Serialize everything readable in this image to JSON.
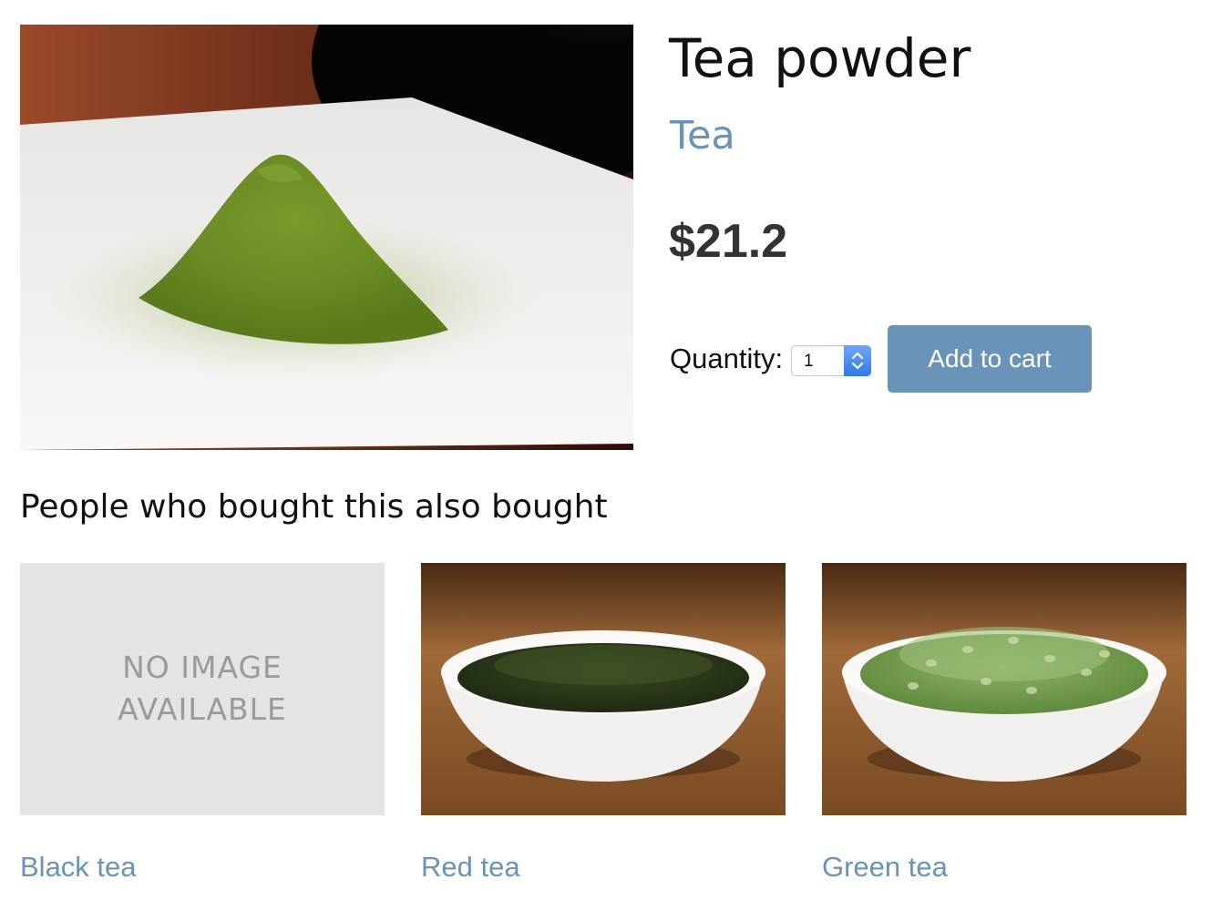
{
  "product": {
    "image_icon": "matcha-powder-photo",
    "title": "Tea powder",
    "category": "Tea",
    "price": "$21.2",
    "quantity_label": "Quantity:",
    "quantity_value": "1",
    "add_to_cart_label": "Add to cart"
  },
  "related": {
    "heading": "People who bought this also bought",
    "items": [
      {
        "name": "Black tea",
        "image": "no-image-placeholder",
        "placeholder_line1": "NO IMAGE",
        "placeholder_line2": "AVAILABLE"
      },
      {
        "name": "Red tea",
        "image": "sencha-leaves-bowl-photo"
      },
      {
        "name": "Green tea",
        "image": "genmaicha-bowl-photo"
      }
    ]
  },
  "colors": {
    "link": "#6a93b6",
    "button_bg": "#6a93b9",
    "button_text": "#ffffff",
    "price_text": "#333333",
    "placeholder_bg": "#e4e4e4",
    "placeholder_text": "#9a9a9a"
  }
}
